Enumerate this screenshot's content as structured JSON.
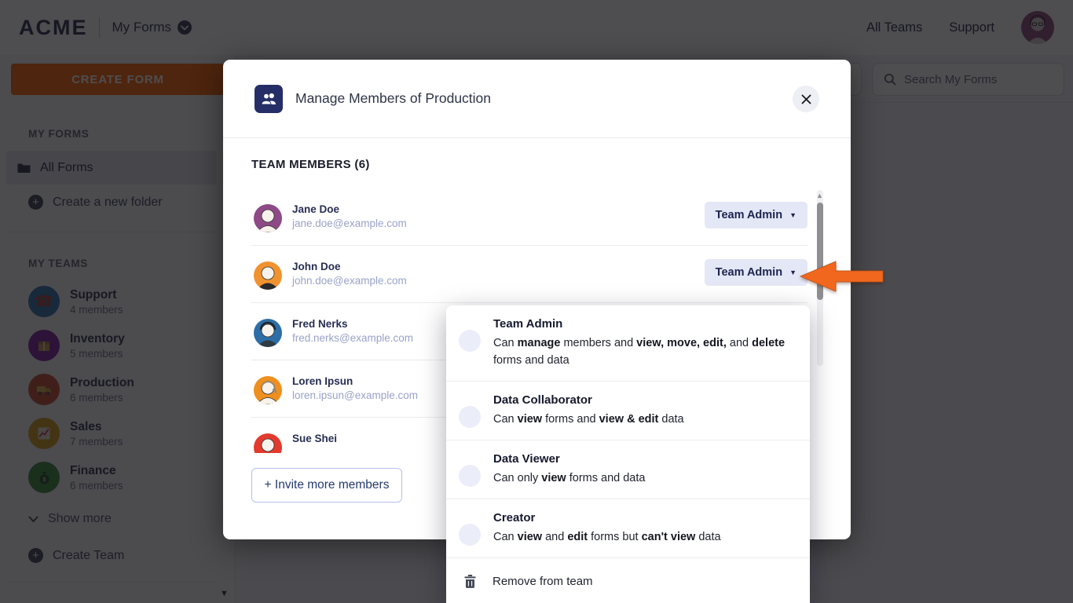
{
  "topbar": {
    "logo": "ACME",
    "workspace": "My Forms",
    "all_teams": "All Teams",
    "support": "Support"
  },
  "search": {
    "placeholder": "Search My Forms"
  },
  "sidebar": {
    "create_form": "CREATE FORM",
    "create_form_color": "#ff6100",
    "my_forms_label": "MY FORMS",
    "all_forms": "All Forms",
    "create_folder": "Create a new folder",
    "my_teams_label": "MY TEAMS",
    "teams": [
      {
        "name": "Support",
        "members": "4 members",
        "color": "#2d74b5",
        "icon": "phone-icon"
      },
      {
        "name": "Inventory",
        "members": "5 members",
        "color": "#7d1fa0",
        "icon": "package-icon"
      },
      {
        "name": "Production",
        "members": "6 members",
        "color": "#c64a33",
        "icon": "truck-icon"
      },
      {
        "name": "Sales",
        "members": "7 members",
        "color": "#d3a21a",
        "icon": "chart-icon"
      },
      {
        "name": "Finance",
        "members": "6 members",
        "color": "#3a8a3e",
        "icon": "money-bag-icon"
      }
    ],
    "show_more": "Show more",
    "create_team": "Create Team"
  },
  "modal": {
    "title": "Manage Members of Production",
    "section_label": "TEAM MEMBERS (6)",
    "members": [
      {
        "name": "Jane Doe",
        "email": "jane.doe@example.com",
        "role": "Team Admin",
        "avatar_color": "#8d4a87"
      },
      {
        "name": "John Doe",
        "email": "john.doe@example.com",
        "role": "Team Admin",
        "avatar_color": "#f0922f"
      },
      {
        "name": "Fred Nerks",
        "email": "fred.nerks@example.com",
        "avatar_color": "#2d6ea6"
      },
      {
        "name": "Loren Ipsun",
        "email": "loren.ipsun@example.com",
        "avatar_color": "#ef8f1f"
      },
      {
        "name": "Sue Shei",
        "avatar_color": "#e23a2e"
      }
    ],
    "invite_button": "+ Invite more members"
  },
  "role_menu": {
    "radio_color": "#ebedf9",
    "options": [
      {
        "title": "Team Admin",
        "desc": [
          {
            "t": "Can ",
            "b": 0
          },
          {
            "t": "manage",
            "b": 1
          },
          {
            "t": " members and ",
            "b": 0
          },
          {
            "t": "view, move, edit,",
            "b": 1
          },
          {
            "t": " and ",
            "b": 0
          },
          {
            "t": "delete",
            "b": 1
          },
          {
            "t": " forms and data",
            "b": 0
          }
        ]
      },
      {
        "title": "Data Collaborator",
        "desc": [
          {
            "t": "Can ",
            "b": 0
          },
          {
            "t": "view",
            "b": 1
          },
          {
            "t": " forms and ",
            "b": 0
          },
          {
            "t": "view & edit",
            "b": 1
          },
          {
            "t": " data",
            "b": 0
          }
        ]
      },
      {
        "title": "Data Viewer",
        "desc": [
          {
            "t": "Can only ",
            "b": 0
          },
          {
            "t": "view",
            "b": 1
          },
          {
            "t": " forms and data",
            "b": 0
          }
        ]
      },
      {
        "title": "Creator",
        "desc": [
          {
            "t": "Can ",
            "b": 0
          },
          {
            "t": "view",
            "b": 1
          },
          {
            "t": " and ",
            "b": 0
          },
          {
            "t": "edit",
            "b": 1
          },
          {
            "t": " forms but ",
            "b": 0
          },
          {
            "t": "can't view",
            "b": 1
          },
          {
            "t": " data",
            "b": 0
          }
        ]
      }
    ],
    "remove": "Remove from team"
  },
  "annotation": {
    "arrow_color": "#f2671e"
  }
}
